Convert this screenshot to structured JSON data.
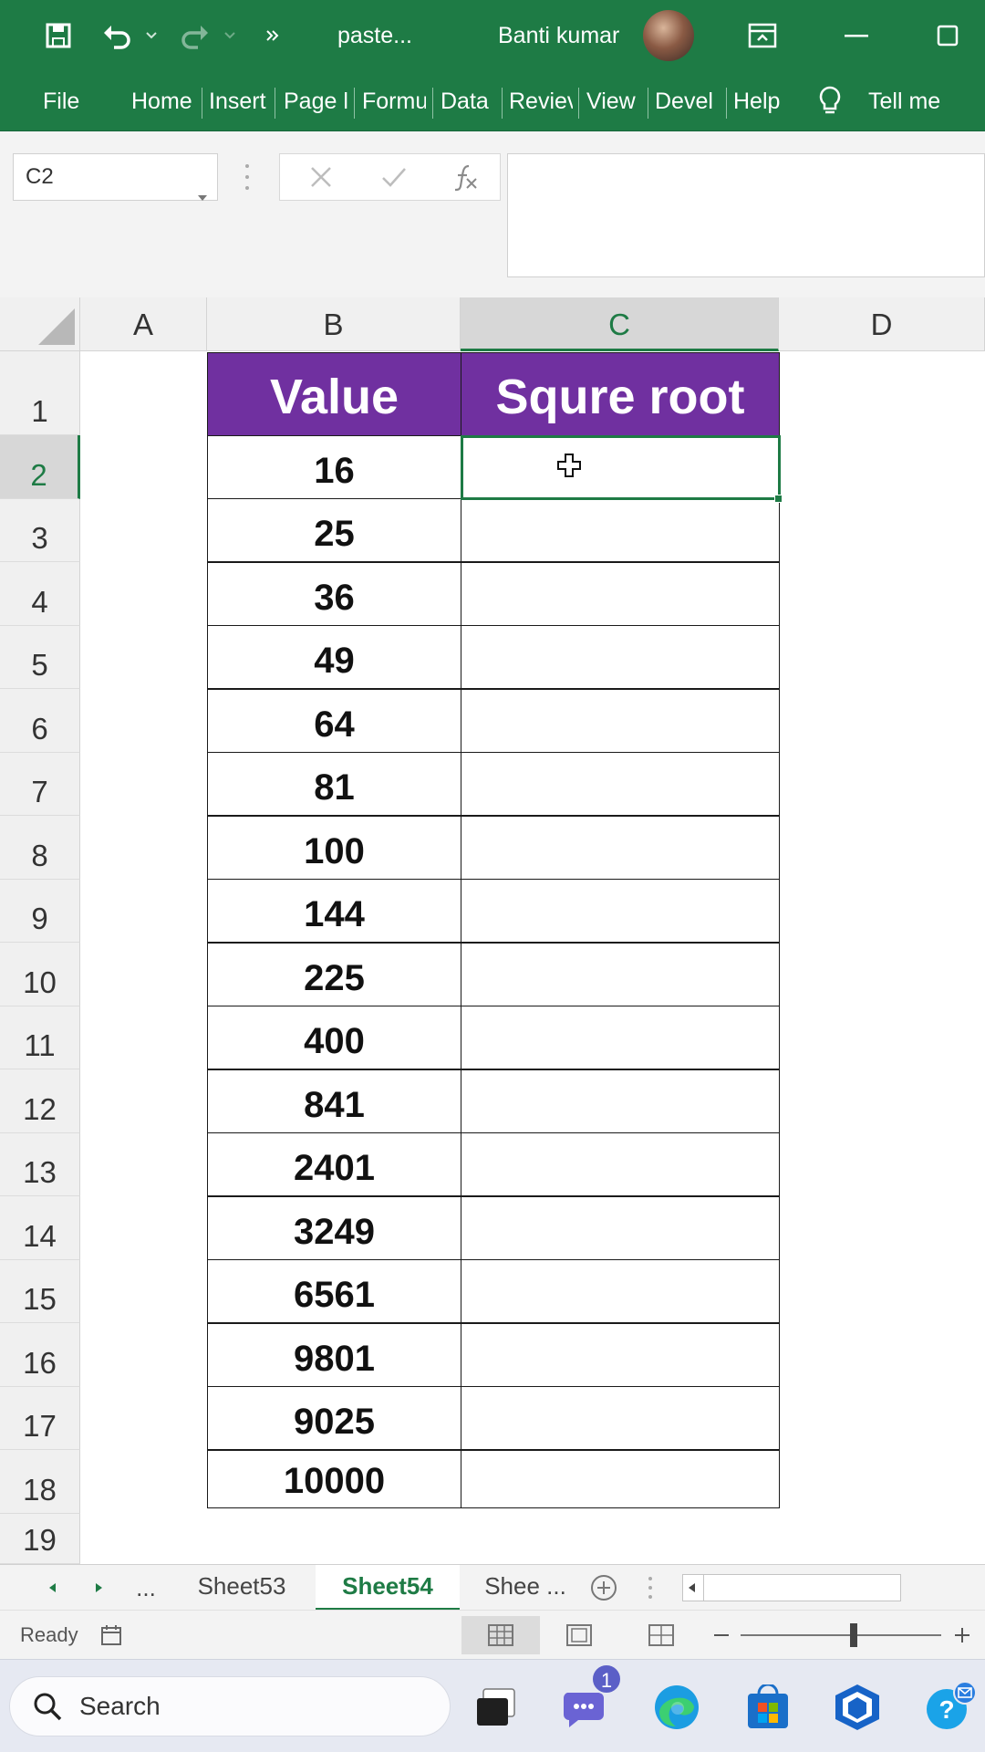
{
  "window": {
    "title": "paste...",
    "user_name": "Banti kumar"
  },
  "ribbon": {
    "tabs": [
      "File",
      "Home",
      "Insert",
      "Page l",
      "Formu",
      "Data",
      "Reviev",
      "View",
      "Devel",
      "Help",
      "Tell me"
    ]
  },
  "formula_bar": {
    "name_box": "C2",
    "formula": ""
  },
  "grid": {
    "columns": [
      "A",
      "B",
      "C",
      "D"
    ],
    "active_column": "C",
    "rows": [
      "1",
      "2",
      "3",
      "4",
      "5",
      "6",
      "7",
      "8",
      "9",
      "10",
      "11",
      "12",
      "13",
      "14",
      "15",
      "16",
      "17",
      "18",
      "19"
    ],
    "active_row": "2",
    "header_value": "Value",
    "header_sqrt": "Squre root",
    "header_fill_color": "#7030a0",
    "values": [
      "16",
      "25",
      "36",
      "49",
      "64",
      "81",
      "100",
      "144",
      "225",
      "400",
      "841",
      "2401",
      "3249",
      "6561",
      "9801",
      "9025",
      "10000"
    ]
  },
  "sheet_tabs": {
    "overflow": "...",
    "tabs": [
      "Sheet53",
      "Sheet54",
      "Shee ..."
    ],
    "active": "Sheet54"
  },
  "status": {
    "text": "Ready"
  },
  "taskbar": {
    "search_placeholder": "Search",
    "chat_badge": "1"
  },
  "colors": {
    "excel_green": "#1e7b45",
    "header_purple": "#7030a0"
  }
}
